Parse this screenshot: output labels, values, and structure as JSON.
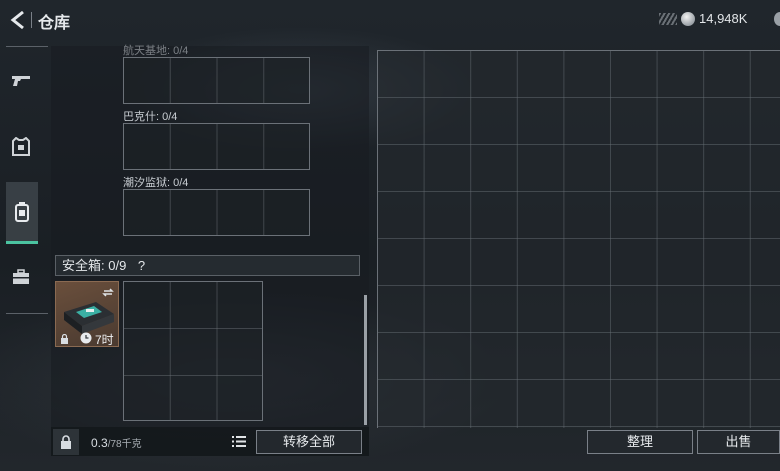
{
  "header": {
    "title": "仓库",
    "currency_value": "14,948K"
  },
  "nav": {
    "items": [
      {
        "name": "weapons",
        "icon": "pistol-icon"
      },
      {
        "name": "equipment",
        "icon": "armor-icon"
      },
      {
        "name": "inventory",
        "icon": "backpack-icon",
        "active": true
      },
      {
        "name": "case",
        "icon": "briefcase-icon"
      }
    ]
  },
  "map_slots": [
    {
      "label": "航天基地: 0/4"
    },
    {
      "label": "巴克什: 0/4"
    },
    {
      "label": "潮汐监狱: 0/4"
    }
  ],
  "safe_box": {
    "label": "安全箱: 0/9",
    "help": "?"
  },
  "item": {
    "timer": "7时",
    "icon": "electronic-device-icon"
  },
  "bottom": {
    "weight": "0.3",
    "weight_max": "/78千克",
    "transfer_label": "转移全部"
  },
  "stash": {
    "sort_label": "整理",
    "sell_label": "出售"
  },
  "colors": {
    "accent": "#4bc3a0"
  }
}
